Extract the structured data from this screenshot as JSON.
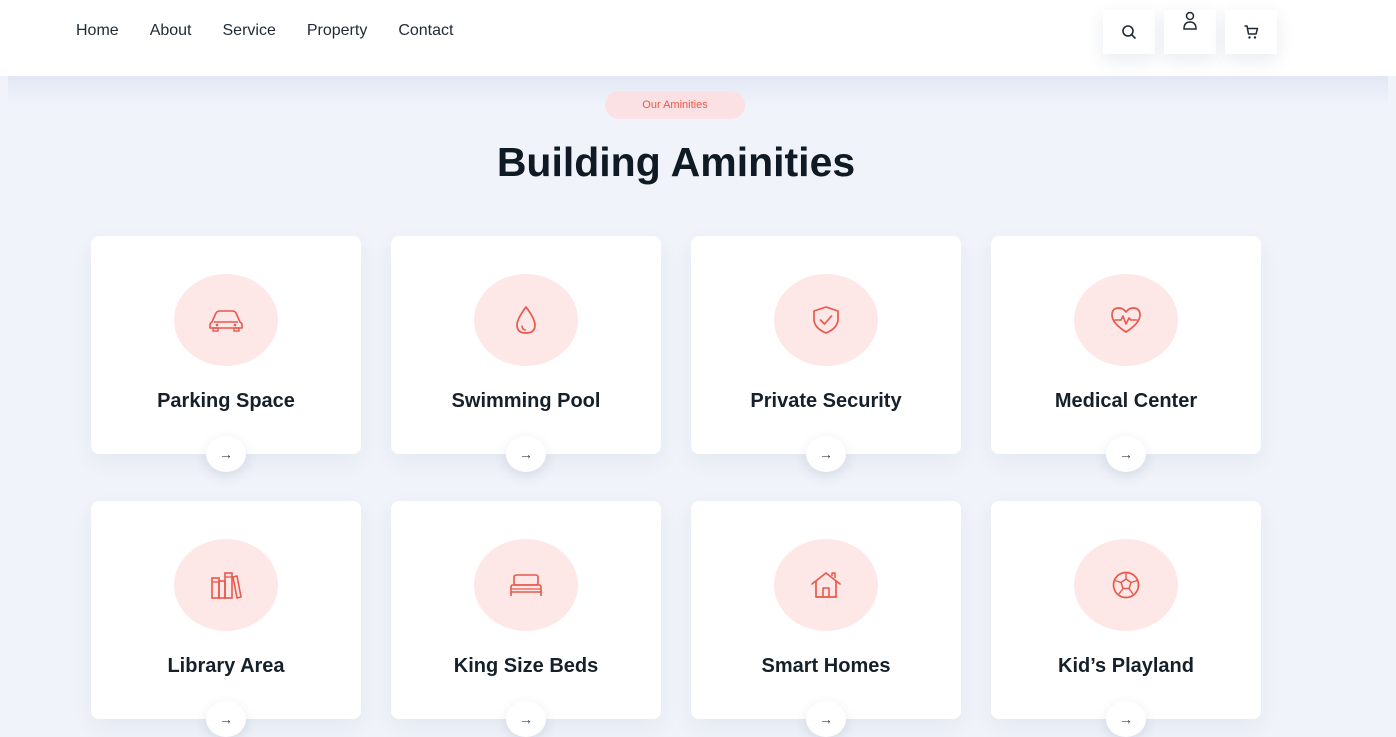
{
  "nav": {
    "links": [
      {
        "label": "Home"
      },
      {
        "label": "About"
      },
      {
        "label": "Service"
      },
      {
        "label": "Property"
      },
      {
        "label": "Contact"
      }
    ],
    "actions": {
      "search_icon": "search-icon",
      "user_icon": "user-icon",
      "cart_icon": "cart-icon"
    }
  },
  "section": {
    "tag": "Our Aminities",
    "title": "Building Aminities"
  },
  "amenities": [
    {
      "title": "Parking Space",
      "icon": "car-icon"
    },
    {
      "title": "Swimming Pool",
      "icon": "water-drop-icon"
    },
    {
      "title": "Private Security",
      "icon": "shield-check-icon"
    },
    {
      "title": "Medical Center",
      "icon": "heart-pulse-icon"
    },
    {
      "title": "Library Area",
      "icon": "books-icon"
    },
    {
      "title": "King Size Beds",
      "icon": "bed-icon"
    },
    {
      "title": "Smart Homes",
      "icon": "home-icon"
    },
    {
      "title": "Kid’s Playland",
      "icon": "soccer-ball-icon"
    }
  ],
  "card_arrow": "→",
  "colors": {
    "accent": "#e8584b",
    "accent_soft": "#fde8e7",
    "page_bg": "#f0f3f9",
    "card_bg": "#ffffff"
  }
}
